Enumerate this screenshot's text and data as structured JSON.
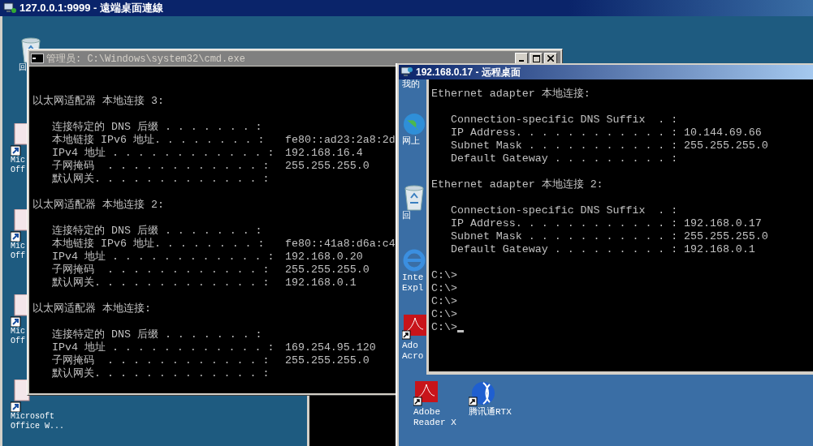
{
  "outer_window": {
    "title": "127.0.0.1:9999 - 遠端桌面連線"
  },
  "desktop_icons": [
    {
      "kind": "recycle-bin",
      "label": [
        "回"
      ]
    },
    {
      "kind": "document",
      "label": [
        "Mic",
        "Off"
      ]
    },
    {
      "kind": "document",
      "label": [
        "Mic",
        "Off"
      ]
    },
    {
      "kind": "document",
      "label": [
        "Mic",
        "Off"
      ]
    },
    {
      "kind": "document",
      "label": [
        "Microsoft",
        "Office W..."
      ]
    }
  ],
  "cmd_window": {
    "title": "管理员: C:\\Windows\\system32\\cmd.exe",
    "active": false,
    "lines": [
      {
        "kind": "blank"
      },
      {
        "kind": "blank"
      },
      {
        "kind": "header",
        "text": "以太网适配器 本地连接 3:"
      },
      {
        "kind": "blank"
      },
      {
        "kind": "field",
        "label": "连接特定的 DNS 后缀 . . . . . . . :"
      },
      {
        "kind": "field",
        "label": "本地链接 IPv6 地址. . . . . . . . :",
        "value": "fe80::ad23:2a8:2d"
      },
      {
        "kind": "field",
        "label": "IPv4 地址 . . . . . . . . . . . . :",
        "value": "192.168.16.4"
      },
      {
        "kind": "field",
        "label": "子网掩码  . . . . . . . . . . . . :",
        "value": "255.255.255.0"
      },
      {
        "kind": "field",
        "label": "默认网关. . . . . . . . . . . . . :"
      },
      {
        "kind": "blank"
      },
      {
        "kind": "header",
        "text": "以太网适配器 本地连接 2:"
      },
      {
        "kind": "blank"
      },
      {
        "kind": "field",
        "label": "连接特定的 DNS 后缀 . . . . . . . :"
      },
      {
        "kind": "field",
        "label": "本地链接 IPv6 地址. . . . . . . . :",
        "value": "fe80::41a8:d6a:c4"
      },
      {
        "kind": "field",
        "label": "IPv4 地址 . . . . . . . . . . . . :",
        "value": "192.168.0.20"
      },
      {
        "kind": "field",
        "label": "子网掩码  . . . . . . . . . . . . :",
        "value": "255.255.255.0"
      },
      {
        "kind": "field",
        "label": "默认网关. . . . . . . . . . . . . :",
        "value": "192.168.0.1"
      },
      {
        "kind": "blank"
      },
      {
        "kind": "header",
        "text": "以太网适配器 本地连接:"
      },
      {
        "kind": "blank"
      },
      {
        "kind": "field",
        "label": "连接特定的 DNS 后缀 . . . . . . . :"
      },
      {
        "kind": "field",
        "label": "IPv4 地址 . . . . . . . . . . . . :",
        "value": "169.254.95.120"
      },
      {
        "kind": "field",
        "label": "子网掩码  . . . . . . . . . . . . :",
        "value": "255.255.255.0"
      },
      {
        "kind": "field",
        "label": "默认网关. . . . . . . . . . . . . :"
      }
    ]
  },
  "remote_window": {
    "title": "192.168.0.17 - 远程桌面",
    "active": true,
    "desktop_icons": [
      {
        "kind": "folder",
        "label": [
          "我的"
        ]
      },
      {
        "kind": "globe",
        "label": [
          "网上"
        ]
      },
      {
        "kind": "recycle-bin",
        "label": [
          "回"
        ]
      },
      {
        "kind": "browser",
        "label": [
          "Inte",
          "Expl"
        ]
      },
      {
        "kind": "pdf",
        "label": [
          "Ado",
          "Acro"
        ]
      },
      {
        "kind": "pdf",
        "label": [
          "Adobe",
          "Reader X"
        ]
      },
      {
        "kind": "messenger",
        "label": [
          "腾讯通RTX"
        ]
      }
    ],
    "console": {
      "lines": [
        {
          "kind": "header",
          "text": "Ethernet adapter 本地连接:"
        },
        {
          "kind": "blank"
        },
        {
          "kind": "field",
          "label": "Connection-specific DNS Suffix  . :"
        },
        {
          "kind": "field",
          "label": "IP Address. . . . . . . . . . . . :",
          "value": "10.144.69.66"
        },
        {
          "kind": "field",
          "label": "Subnet Mask . . . . . . . . . . . :",
          "value": "255.255.255.0"
        },
        {
          "kind": "field",
          "label": "Default Gateway . . . . . . . . . :"
        },
        {
          "kind": "blank"
        },
        {
          "kind": "header",
          "text": "Ethernet adapter 本地连接 2:"
        },
        {
          "kind": "blank"
        },
        {
          "kind": "field",
          "label": "Connection-specific DNS Suffix  . :"
        },
        {
          "kind": "field",
          "label": "IP Address. . . . . . . . . . . . :",
          "value": "192.168.0.17"
        },
        {
          "kind": "field",
          "label": "Subnet Mask . . . . . . . . . . . :",
          "value": "255.255.255.0"
        },
        {
          "kind": "field",
          "label": "Default Gateway . . . . . . . . . :",
          "value": "192.168.0.1"
        },
        {
          "kind": "blank"
        },
        {
          "kind": "prompt",
          "text": "C:\\>",
          "cursor": false
        },
        {
          "kind": "prompt",
          "text": "C:\\>",
          "cursor": false
        },
        {
          "kind": "prompt",
          "text": "C:\\>",
          "cursor": false
        },
        {
          "kind": "prompt",
          "text": "C:\\>",
          "cursor": false
        },
        {
          "kind": "prompt",
          "text": "C:\\>",
          "cursor": true
        }
      ]
    }
  }
}
